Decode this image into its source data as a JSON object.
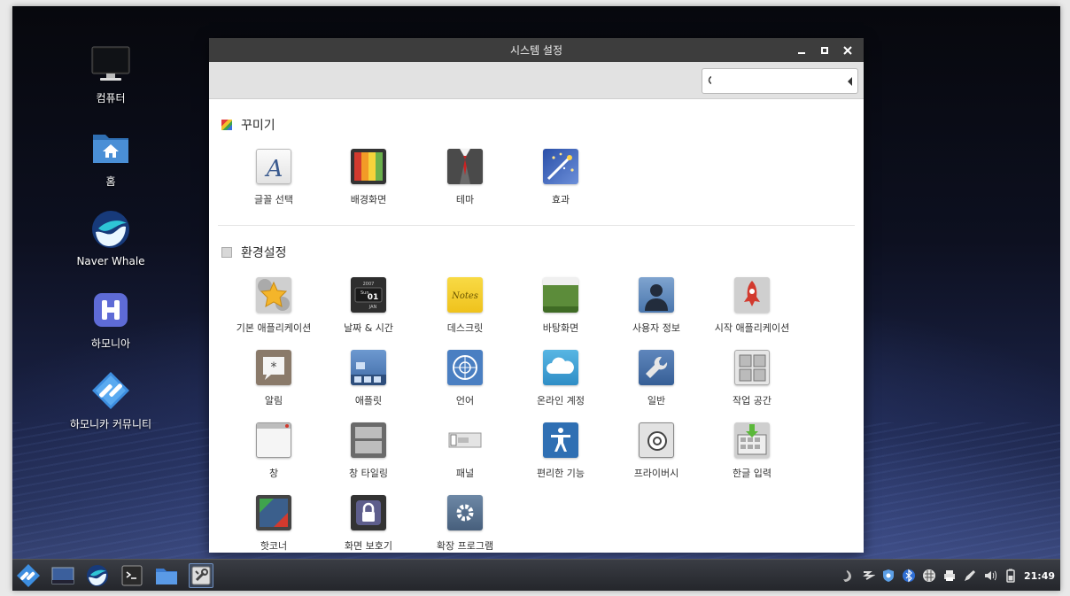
{
  "desktop": {
    "icons": [
      {
        "label": "컴퓨터"
      },
      {
        "label": "홈"
      },
      {
        "label": "Naver Whale"
      },
      {
        "label": "하모니아"
      },
      {
        "label": "하모니카 커뮤니티"
      }
    ]
  },
  "window": {
    "title": "시스템 설정",
    "search": {
      "value": "",
      "placeholder": ""
    },
    "sections": [
      {
        "title": "꾸미기",
        "items": [
          {
            "label": "글꼴 선택",
            "icon": "font-icon"
          },
          {
            "label": "배경화면",
            "icon": "wallpaper-icon"
          },
          {
            "label": "테마",
            "icon": "theme-icon"
          },
          {
            "label": "효과",
            "icon": "effects-icon"
          }
        ]
      },
      {
        "title": "환경설정",
        "items": [
          {
            "label": "기본 애플리케이션",
            "icon": "preferred-apps-icon"
          },
          {
            "label": "날짜 & 시간",
            "icon": "calendar-icon"
          },
          {
            "label": "데스크릿",
            "icon": "desklet-icon"
          },
          {
            "label": "바탕화면",
            "icon": "desktop-icon"
          },
          {
            "label": "사용자 정보",
            "icon": "user-icon"
          },
          {
            "label": "시작 애플리케이션",
            "icon": "startup-icon"
          },
          {
            "label": "알림",
            "icon": "notification-icon"
          },
          {
            "label": "애플릿",
            "icon": "applet-icon"
          },
          {
            "label": "언어",
            "icon": "language-icon"
          },
          {
            "label": "온라인 계정",
            "icon": "cloud-icon"
          },
          {
            "label": "일반",
            "icon": "wrench-icon"
          },
          {
            "label": "작업 공간",
            "icon": "workspace-icon"
          },
          {
            "label": "창",
            "icon": "window-icon"
          },
          {
            "label": "창 타일링",
            "icon": "tiling-icon"
          },
          {
            "label": "패널",
            "icon": "panel-icon"
          },
          {
            "label": "편리한 기능",
            "icon": "accessibility-icon"
          },
          {
            "label": "프라이버시",
            "icon": "privacy-icon"
          },
          {
            "label": "한글 입력",
            "icon": "keyboard-icon"
          },
          {
            "label": "핫코너",
            "icon": "hotcorner-icon"
          },
          {
            "label": "화면 보호기",
            "icon": "lock-icon"
          },
          {
            "label": "확장 프로그램",
            "icon": "extensions-icon"
          }
        ]
      }
    ],
    "calendar_icon": {
      "year": "2007",
      "day": "Sun",
      "date": "01",
      "month": "JAN"
    },
    "desklet_text": "Notes"
  },
  "taskbar": {
    "clock": "21:49"
  }
}
